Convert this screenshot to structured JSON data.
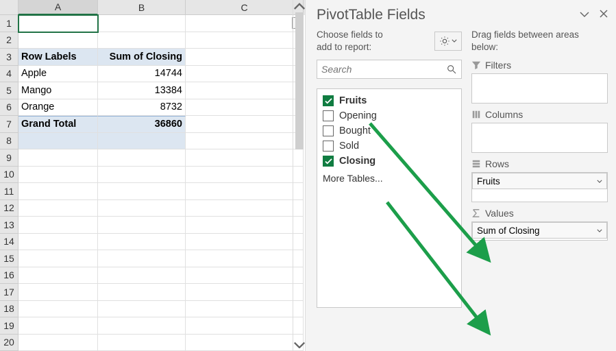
{
  "sheet": {
    "col_headers": [
      "A",
      "B",
      "C"
    ],
    "row_headers": [
      1,
      2,
      3,
      4,
      5,
      6,
      7,
      8,
      9,
      10,
      11,
      12,
      13,
      14,
      15,
      16,
      17,
      18,
      19,
      20
    ],
    "pivot": {
      "header_a": "Row Labels",
      "header_b": "Sum of Closing",
      "rows": [
        {
          "label": "Apple",
          "value": "14744"
        },
        {
          "label": "Mango",
          "value": "13384"
        },
        {
          "label": "Orange",
          "value": "8732"
        }
      ],
      "total_label": "Grand Total",
      "total_value": "36860"
    }
  },
  "panel": {
    "title": "PivotTable Fields",
    "choose_hint": "Choose fields to add to report:",
    "drag_hint": "Drag fields between areas below:",
    "search_placeholder": "Search",
    "fields": [
      {
        "name": "Fruits",
        "checked": true
      },
      {
        "name": "Opening",
        "checked": false
      },
      {
        "name": "Bought",
        "checked": false
      },
      {
        "name": "Sold",
        "checked": false
      },
      {
        "name": "Closing",
        "checked": true
      }
    ],
    "more_tables": "More Tables...",
    "sections": {
      "filters": "Filters",
      "columns": "Columns",
      "rows": "Rows",
      "values": "Values"
    },
    "rows_pill": "Fruits",
    "values_pill": "Sum of Closing"
  }
}
